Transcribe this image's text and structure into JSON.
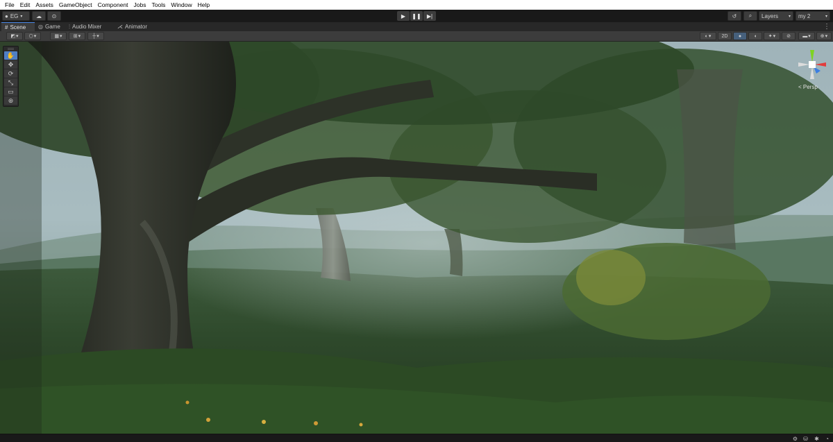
{
  "menu": [
    "File",
    "Edit",
    "Assets",
    "GameObject",
    "Component",
    "Jobs",
    "Tools",
    "Window",
    "Help"
  ],
  "toolbar": {
    "account_label": "EG",
    "layers_label": "Layers",
    "layout_label": "my 2"
  },
  "tabs": [
    {
      "label": "Scene",
      "icon": "hash-icon",
      "active": true
    },
    {
      "label": "Game",
      "icon": "gamepad-icon",
      "active": false
    },
    {
      "label": "Audio Mixer",
      "icon": "mixer-icon",
      "active": false
    },
    {
      "label": "Animator",
      "icon": "animator-icon",
      "active": false
    }
  ],
  "scene_toolbar": {
    "mode_2d_label": "2D"
  },
  "tools": [
    "hand-tool-icon",
    "move-tool-icon",
    "rotate-tool-icon",
    "scale-tool-icon",
    "rect-tool-icon",
    "transform-tool-icon"
  ],
  "active_tool": "hand-tool-icon",
  "gizmo": {
    "projection_label": "< Persp",
    "colors": {
      "x": "#e23c3c",
      "y": "#7ed321",
      "z": "#3c7ee2",
      "center": "#ffffff"
    }
  },
  "colors": {
    "accent": "#4a88e6",
    "menubar_bg": "#ffffff",
    "editor_bg": "#191919",
    "panel_bg": "#3c3c3c"
  }
}
